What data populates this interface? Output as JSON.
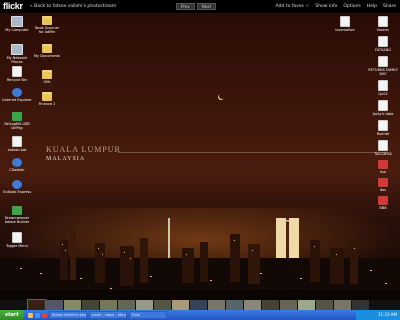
{
  "topbar": {
    "logo": "flickr",
    "back_link": "« Back to fatsee sallehi's photostream",
    "prev": "Prev",
    "next": "Next",
    "links": [
      "Add to faves ☆",
      "Show info",
      "Options",
      "Help",
      "Share"
    ]
  },
  "photo": {
    "title_line1": "KUALA LUMPUR",
    "title_line2": "MALAYSIA"
  },
  "desktop_left": [
    {
      "label": "My Computer",
      "kind": "comp"
    },
    {
      "label": "My Network Places",
      "kind": "comp"
    },
    {
      "label": "Recycle Bin",
      "kind": "doc"
    },
    {
      "label": "Internet Explorer",
      "kind": "blue"
    },
    {
      "label": "RelLogMS-USB DnPag",
      "kind": "green"
    },
    {
      "label": "autosh.bat",
      "kind": "doc"
    },
    {
      "label": "CDsetter",
      "kind": "blue"
    },
    {
      "label": "Outlook Express",
      "kind": "blue"
    },
    {
      "label": "Dreamweaver Adobe Builder",
      "kind": "green"
    },
    {
      "label": "Toggle Menu",
      "kind": "doc"
    }
  ],
  "desktop_col2": [
    {
      "label": "Nook Scanner for AdMin",
      "kind": "folder"
    },
    {
      "label": "My Documents",
      "kind": "folder"
    },
    {
      "label": "Offs",
      "kind": "folder"
    },
    {
      "label": "Finance 2",
      "kind": "folder"
    }
  ],
  "desktop_right": [
    {
      "label": "tbsens",
      "kind": "doc"
    },
    {
      "label": "FATSANG",
      "kind": "doc"
    },
    {
      "label": "RETURNS FAMILY DAY",
      "kind": "doc"
    },
    {
      "label": "Qu02",
      "kind": "doc"
    },
    {
      "label": "Jacky's data",
      "kind": "doc"
    },
    {
      "label": "Ruente",
      "kind": "doc"
    },
    {
      "label": "TAG-DESK",
      "kind": "doc"
    },
    {
      "label": "esa",
      "kind": "red"
    },
    {
      "label": "dos",
      "kind": "red"
    },
    {
      "label": "BBB",
      "kind": "red"
    }
  ],
  "desktop_topright": {
    "label": "locomotive",
    "kind": "doc"
  },
  "taskbar": {
    "start": "start",
    "tasks": [
      "Fatsee Sallehi's photostr...",
      "email - Inbox - Microsoft...",
      "Folio"
    ],
    "clock": "11:23 AM"
  },
  "colors": {
    "taskbar": "#2356c8",
    "start": "#3a9c32",
    "flickr_pink": "#ff0084"
  }
}
